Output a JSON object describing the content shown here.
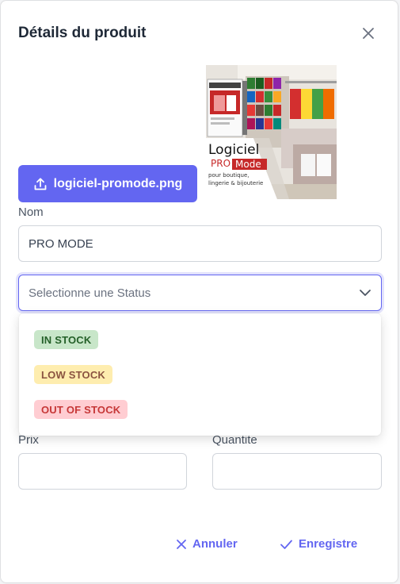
{
  "dialog": {
    "title": "Détails du produit",
    "close_icon": "close-icon"
  },
  "upload": {
    "icon": "upload-icon",
    "filename": "logiciel-promode.png"
  },
  "product_image": {
    "brand_line1": "Logiciel",
    "brand_pro": "PRO",
    "brand_mode": "Mode",
    "tagline1": "pour boutique,",
    "tagline2": "lingerie & bijouterie"
  },
  "form": {
    "name_label": "Nom",
    "name_value": "PRO MODE",
    "status_placeholder": "Selectionne une Status",
    "status_options": [
      {
        "label": "IN STOCK",
        "bg": "#c8e6c9",
        "fg": "#256029"
      },
      {
        "label": "LOW STOCK",
        "bg": "#feedaf",
        "fg": "#8a5340"
      },
      {
        "label": "OUT OF STOCK",
        "bg": "#ffcdd2",
        "fg": "#c63737"
      }
    ],
    "price_label": "Prix",
    "price_value": "",
    "quantity_label": "Quantite",
    "quantity_value": ""
  },
  "actions": {
    "cancel_label": "Annuler",
    "save_label": "Enregistre"
  },
  "colors": {
    "accent": "#6366f1"
  }
}
